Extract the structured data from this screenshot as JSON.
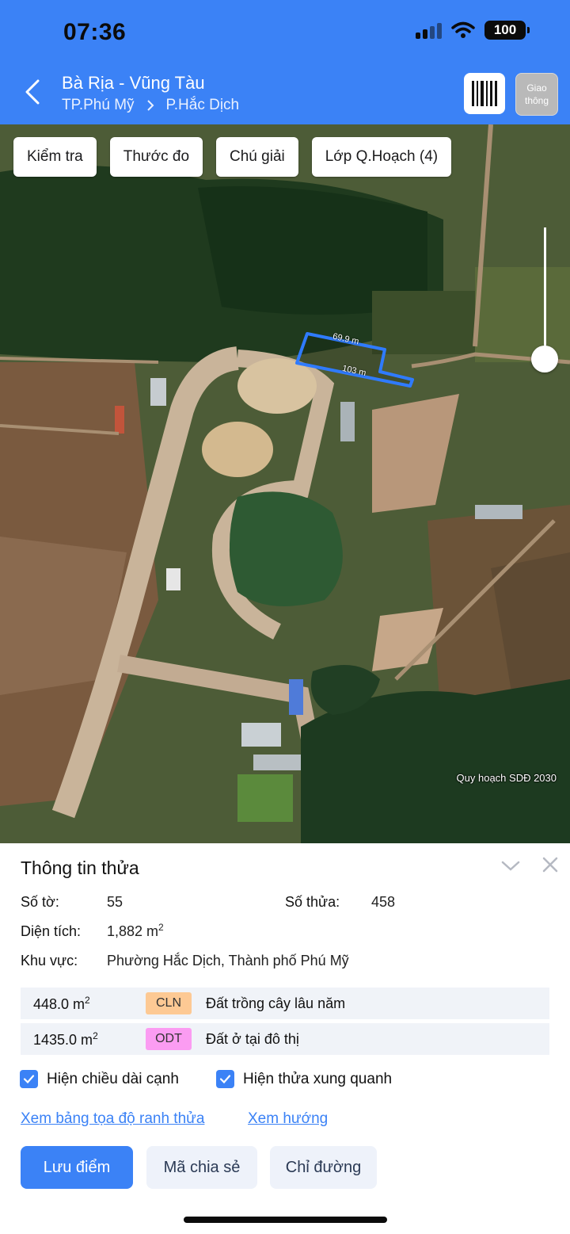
{
  "status_bar": {
    "time": "07:36",
    "battery": "100"
  },
  "header": {
    "title": "Bà Rịa - Vũng Tàu",
    "breadcrumb": {
      "city": "TP.Phú Mỹ",
      "ward": "P.Hắc Dịch"
    },
    "traffic_label": "Giao thông"
  },
  "map": {
    "tools": [
      "Kiểm tra",
      "Thước đo",
      "Chú giải",
      "Lớp Q.Hoạch (4)"
    ],
    "dimension_top": "69.9 m",
    "dimension_bottom": "103 m",
    "caption": "Quy hoạch SDĐ 2030",
    "parcel_color": "#2f7bff"
  },
  "parcel_info": {
    "title": "Thông tin thửa",
    "so_to_label": "Số tờ:",
    "so_to_value": "55",
    "so_thua_label": "Số thửa:",
    "so_thua_value": "458",
    "dien_tich_label": "Diện tích:",
    "dien_tich_value": "1,882 m",
    "khu_vuc_label": "Khu vực:",
    "khu_vuc_value": "Phường Hắc Dịch, Thành phố Phú Mỹ",
    "land_uses": [
      {
        "area": "448.0 m",
        "code": "CLN",
        "description": "Đất trồng cây lâu năm",
        "color": "#fdc994"
      },
      {
        "area": "1435.0 m",
        "code": "ODT",
        "description": "Đất ở tại đô thị",
        "color": "#fb9cf2"
      }
    ],
    "checkboxes": [
      {
        "label": "Hiện chiều dài cạnh",
        "checked": true
      },
      {
        "label": "Hiện thửa xung quanh",
        "checked": true
      }
    ],
    "links": {
      "coords": "Xem bảng tọa độ ranh thửa",
      "direction": "Xem hướng"
    },
    "buttons": {
      "save": "Lưu điểm",
      "share": "Mã chia sẻ",
      "route": "Chỉ đường"
    }
  },
  "colors": {
    "accent": "#3b82f6"
  }
}
